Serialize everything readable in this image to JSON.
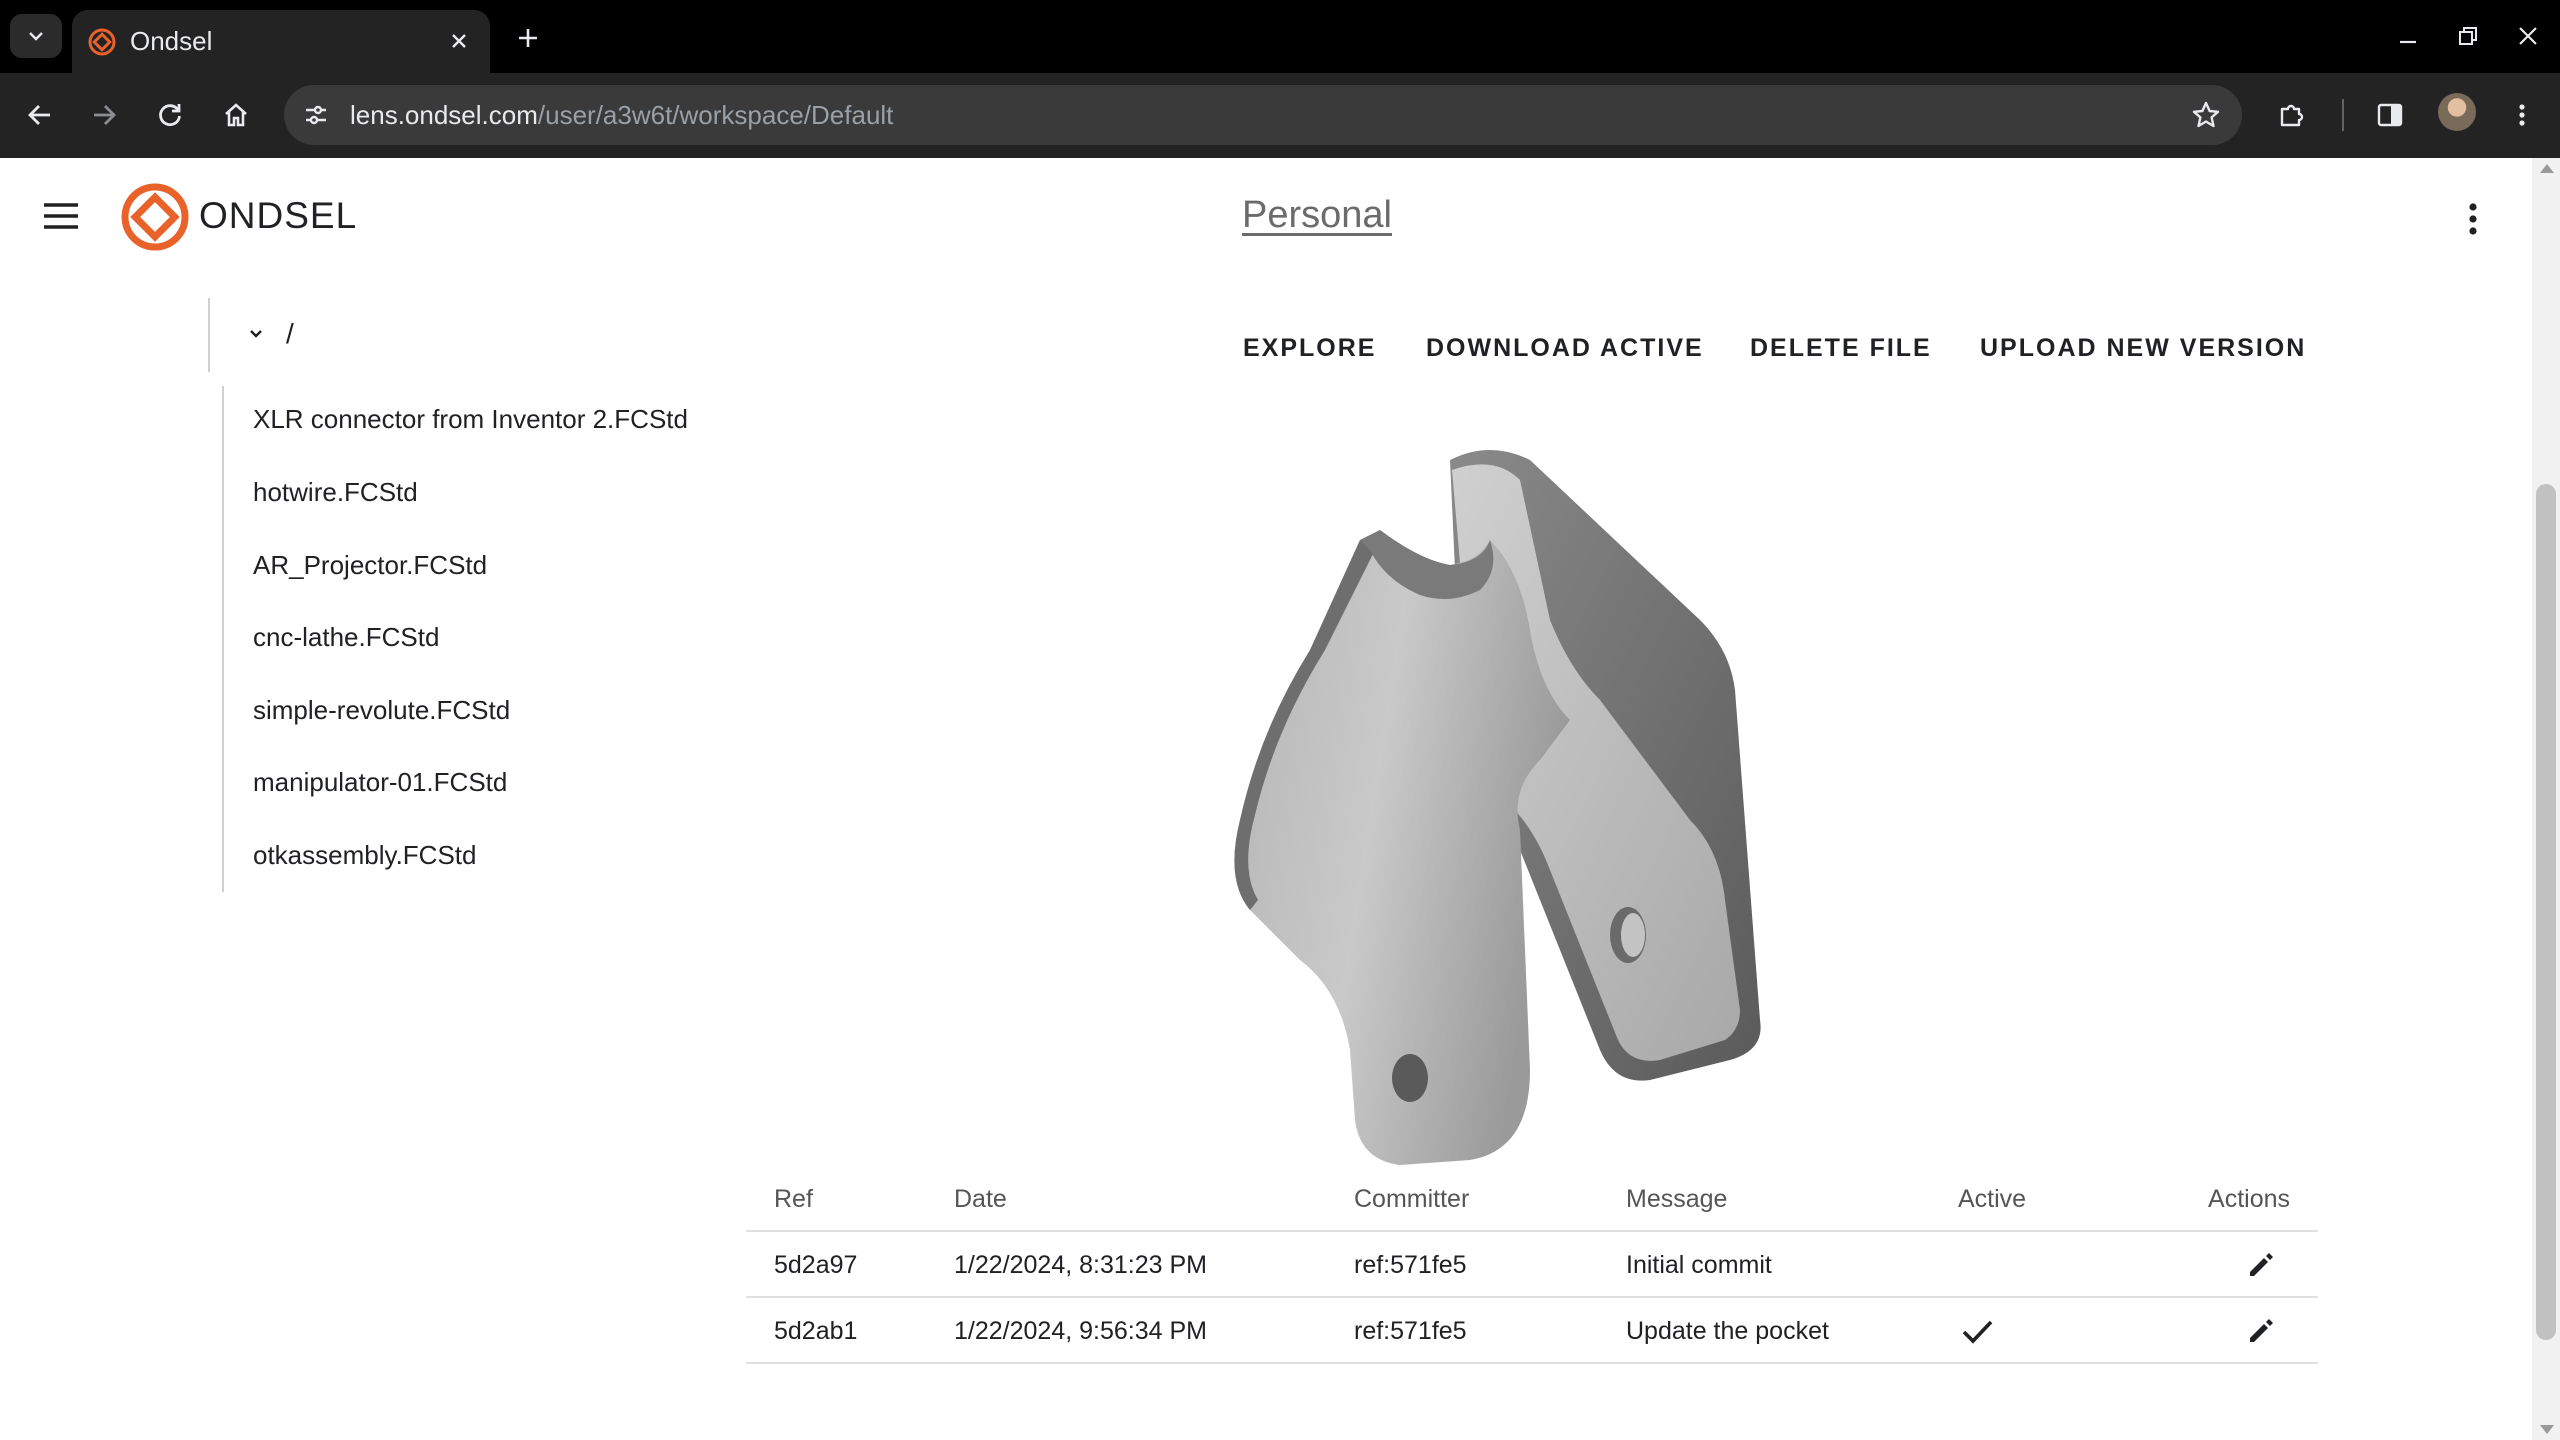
{
  "browser": {
    "tab_title": "Ondsel",
    "url_host": "lens.ondsel.com",
    "url_path": "/user/a3w6t/workspace/Default"
  },
  "app": {
    "logo_text": "ONDSEL",
    "workspace_title": "Personal"
  },
  "tree": {
    "root_label": "/",
    "files": [
      "XLR connector from Inventor 2.FCStd",
      "hotwire.FCStd",
      "AR_Projector.FCStd",
      "cnc-lathe.FCStd",
      "simple-revolute.FCStd",
      "manipulator-01.FCStd",
      "otkassembly.FCStd"
    ]
  },
  "actions": {
    "explore": "EXPLORE",
    "download_active": "DOWNLOAD ACTIVE",
    "delete_file": "DELETE FILE",
    "upload_new_version": "UPLOAD NEW VERSION"
  },
  "versions": {
    "headers": {
      "ref": "Ref",
      "date": "Date",
      "committer": "Committer",
      "message": "Message",
      "active": "Active",
      "actions": "Actions"
    },
    "rows": [
      {
        "ref": "5d2a97",
        "date": "1/22/2024, 8:31:23 PM",
        "committer": "ref:571fe5",
        "message": "Initial commit",
        "active": false
      },
      {
        "ref": "5d2ab1",
        "date": "1/22/2024, 9:56:34 PM",
        "committer": "ref:571fe5",
        "message": "Update the pocket",
        "active": true
      }
    ]
  },
  "icons": {
    "brand_color": "#e8622a",
    "tab_favicon": "ondsel-logo-icon",
    "menu": "hamburger-menu-icon",
    "more": "more-vert-icon",
    "edit": "pencil-icon",
    "active": "checkmark-icon"
  }
}
